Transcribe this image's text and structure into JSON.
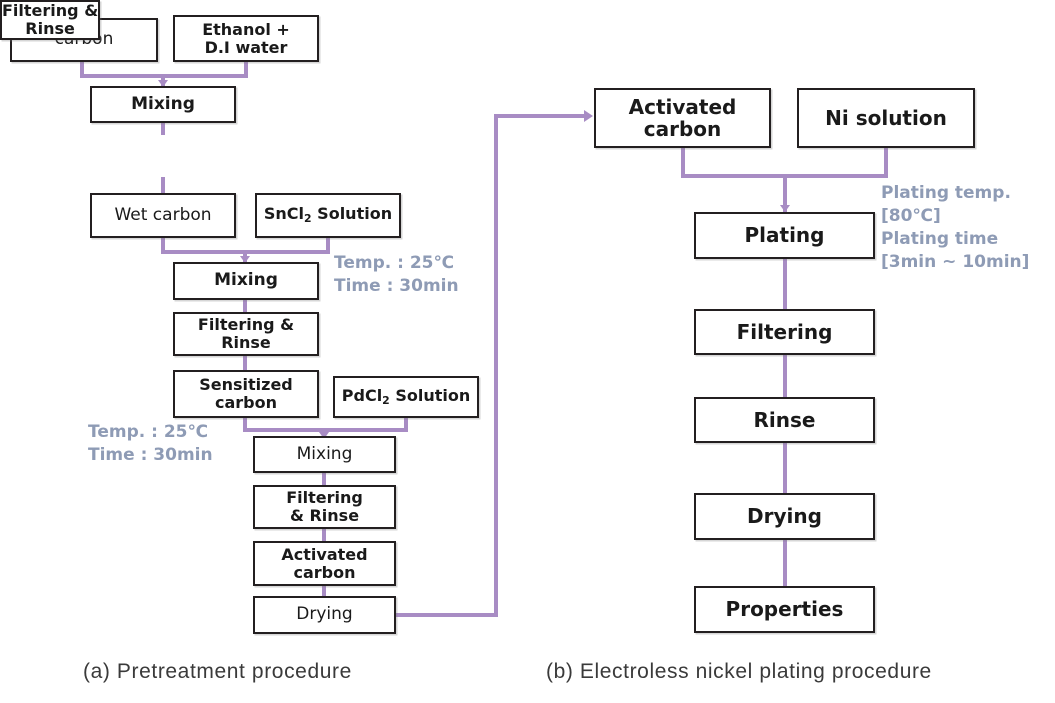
{
  "figure": {
    "panels": [
      {
        "id": "a",
        "caption": "(a) Pretreatment  procedure",
        "nodes": [
          {
            "key": "carbon",
            "label": "carbon"
          },
          {
            "key": "ethanol_di",
            "label": "Ethanol +\nD.I water"
          },
          {
            "key": "mixing_1",
            "label": "Mixing"
          },
          {
            "key": "filtering_1",
            "label": "Filtering  &\nRinse"
          },
          {
            "key": "wet_carbon",
            "label": "Wet carbon"
          },
          {
            "key": "sncl2",
            "label": "SnCl2 Solution"
          },
          {
            "key": "mixing_2",
            "label": "Mixing"
          },
          {
            "key": "filtering_2",
            "label": "Filtering  &\nRinse"
          },
          {
            "key": "sensitized",
            "label": "Sensitized\ncarbon"
          },
          {
            "key": "pdcl2",
            "label": "PdCl2 Solution"
          },
          {
            "key": "mixing_3",
            "label": "Mixing"
          },
          {
            "key": "filtering_3",
            "label": "Filtering\n& Rinse"
          },
          {
            "key": "activated",
            "label": "Activated\ncarbon"
          },
          {
            "key": "drying",
            "label": "Drying"
          }
        ],
        "notes": [
          {
            "key": "note_sn",
            "text": "Temp. : 25℃\nTime : 30min"
          },
          {
            "key": "note_pd",
            "text": "Temp. : 25℃\nTime : 30min"
          }
        ]
      },
      {
        "id": "b",
        "caption": "(b)  Electroless  nickel  plating  procedure",
        "nodes": [
          {
            "key": "activated_b",
            "label": "Activated\ncarbon"
          },
          {
            "key": "ni_solution",
            "label": "Ni solution"
          },
          {
            "key": "plating",
            "label": "Plating"
          },
          {
            "key": "filtering_b",
            "label": "Filtering"
          },
          {
            "key": "rinse_b",
            "label": "Rinse"
          },
          {
            "key": "drying_b",
            "label": "Drying"
          },
          {
            "key": "properties",
            "label": "Properties"
          }
        ],
        "notes": [
          {
            "key": "note_plating",
            "text": "Plating temp.\n [80℃]\nPlating time\n [3min ~ 10min]"
          }
        ]
      }
    ]
  },
  "colors": {
    "connector": "#a88cc4",
    "box_border": "#231f20",
    "note_text": "#8e9bb5",
    "caption_text": "#3a3a3a",
    "background": "#ffffff"
  }
}
